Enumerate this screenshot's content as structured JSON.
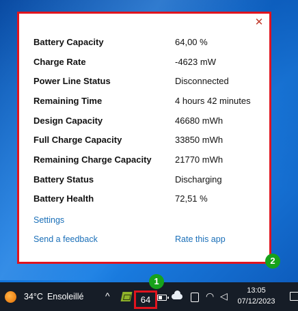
{
  "popup": {
    "close_glyph": "✕",
    "rows": [
      {
        "label": "Battery Capacity",
        "value": "64,00 %"
      },
      {
        "label": "Charge Rate",
        "value": "-4623 mW"
      },
      {
        "label": "Power Line Status",
        "value": "Disconnected"
      },
      {
        "label": "Remaining Time",
        "value": "4 hours 42 minutes"
      },
      {
        "label": "Design Capacity",
        "value": "46680 mWh"
      },
      {
        "label": "Full Charge Capacity",
        "value": "33850 mWh"
      },
      {
        "label": "Remaining Charge Capacity",
        "value": "21770 mWh"
      },
      {
        "label": "Battery Status",
        "value": "Discharging"
      },
      {
        "label": "Battery Health",
        "value": "72,51 %"
      }
    ],
    "links": {
      "settings": "Settings",
      "feedback": "Send a feedback",
      "rate": "Rate this app"
    }
  },
  "annotations": {
    "badge_1": "1",
    "badge_2": "2"
  },
  "taskbar": {
    "weather": {
      "icon": "sun-icon",
      "temperature": "34°C",
      "condition": "Ensoleillé"
    },
    "tray": {
      "chevron_glyph": "^",
      "battery_percent": "64",
      "wifi_glyph": "◠",
      "speaker_glyph": "◁"
    },
    "clock": {
      "time": "13:05",
      "date": "07/12/2023"
    }
  },
  "colors": {
    "highlight_border": "#e0141e",
    "badge": "#17a21b",
    "link": "#1a6fb8",
    "taskbar": "#161d27"
  }
}
